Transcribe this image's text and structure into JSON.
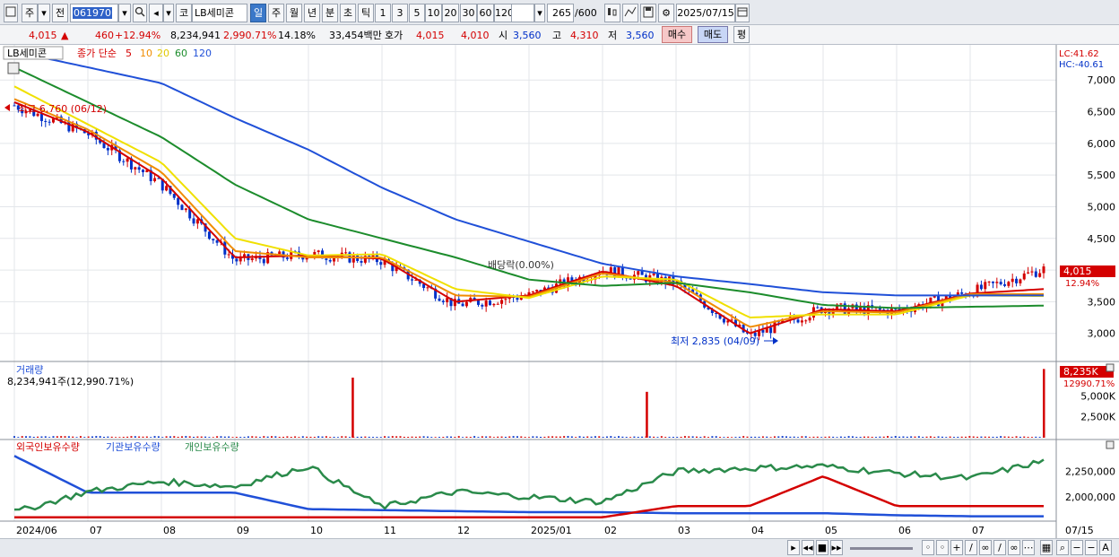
{
  "toolbar": {
    "market_1": "주",
    "market_2": "전",
    "code": "061970",
    "name_prefix": "코",
    "stock_name": "LB세미콘",
    "periods": [
      "일",
      "주",
      "월",
      "년",
      "분",
      "초",
      "틱"
    ],
    "active_period": "일",
    "intervals": [
      "1",
      "3",
      "5",
      "10",
      "20",
      "30",
      "60",
      "120"
    ],
    "count": "265",
    "count_total": "/600",
    "date": "2025/07/15"
  },
  "quote": {
    "price": "4,015",
    "change_arrow": "▲",
    "change": "460",
    "change_pct": "+12.94%",
    "volume": "8,234,941",
    "volume_ratio": "2,990.71%",
    "turnover": "14.18%",
    "amount": "33,454백만",
    "ask_label": "호가",
    "ask": "4,015",
    "bid": "4,010",
    "open_label": "시",
    "open": "3,560",
    "high_label": "고",
    "high": "4,310",
    "low_label": "저",
    "low": "3,560",
    "buy": "매수",
    "sell": "매도",
    "eval": "평"
  },
  "price_panel": {
    "name": "LB세미콘",
    "ma_label": "종가 단순",
    "ma_periods": [
      "5",
      "10",
      "20",
      "60",
      "120"
    ],
    "lc": "LC:41.62",
    "hc": "HC:-40.61",
    "high_note": "최고 6,760 (06/12)",
    "low_note": "최저 2,835 (04/09)",
    "event_note": "배당락(0.00%)",
    "last_price_tag": "4,015",
    "last_pct_tag": "12.94%"
  },
  "volume_panel": {
    "title": "거래량",
    "value": "8,234,941주(12,990.71%)",
    "tag1": "8,235K",
    "tag2": "12990.71%"
  },
  "holdings_panel": {
    "items": [
      "외국인보유수량",
      "기관보유수량",
      "개인보유수량"
    ]
  },
  "x_axis_labels": [
    "2024/06",
    "07",
    "08",
    "09",
    "10",
    "11",
    "12",
    "2025/01",
    "02",
    "03",
    "04",
    "05",
    "06",
    "07"
  ],
  "x_axis_end": "07/15",
  "colors": {
    "up": "#d40000",
    "down": "#0030c8",
    "ma5": "#d40000",
    "ma10": "#f08c00",
    "ma20": "#f0e000",
    "ma60": "#1c8c2c",
    "ma120": "#2050d8",
    "foreign": "#2050d8",
    "institution": "#d40000",
    "individual": "#2a8a4a"
  },
  "chart_data": [
    {
      "type": "line",
      "title": "LB세미콘",
      "ylabel": "",
      "y_ticks": [
        3000,
        3500,
        4000,
        4500,
        5000,
        5500,
        6000,
        6500,
        7000
      ],
      "y_tick_labels": [
        "3,000",
        "3,500",
        "4,000",
        "4,500",
        "5,000",
        "5,500",
        "6,000",
        "6,500",
        "7,000"
      ],
      "ylim": [
        2600,
        7300
      ],
      "x": [
        "2024/06",
        "07",
        "08",
        "09",
        "10",
        "11",
        "12",
        "2025/01",
        "02",
        "03",
        "04",
        "05",
        "06",
        "07"
      ],
      "series": [
        {
          "name": "종가",
          "values": [
            6600,
            6150,
            5350,
            4150,
            4250,
            4150,
            3450,
            3600,
            4000,
            3800,
            2950,
            3400,
            3350,
            3650,
            4015
          ]
        },
        {
          "name": "5",
          "values": [
            6650,
            6180,
            5450,
            4200,
            4230,
            4180,
            3500,
            3600,
            3980,
            3750,
            3000,
            3380,
            3350,
            3630,
            3700
          ]
        },
        {
          "name": "10",
          "values": [
            6700,
            6220,
            5550,
            4300,
            4200,
            4200,
            3600,
            3580,
            3950,
            3800,
            3100,
            3350,
            3330,
            3620,
            3620
          ]
        },
        {
          "name": "20",
          "values": [
            6900,
            6300,
            5700,
            4500,
            4230,
            4250,
            3700,
            3560,
            3900,
            3850,
            3250,
            3300,
            3300,
            3600,
            3590
          ]
        },
        {
          "name": "60",
          "values": [
            7200,
            6650,
            6100,
            5350,
            4800,
            4500,
            4200,
            3850,
            3750,
            3800,
            3650,
            3450,
            3400,
            3420,
            3440
          ]
        },
        {
          "name": "120",
          "values": [
            7450,
            7200,
            6950,
            6400,
            5900,
            5300,
            4800,
            4450,
            4100,
            3900,
            3780,
            3650,
            3600,
            3600,
            3600
          ]
        }
      ]
    },
    {
      "type": "bar",
      "title": "거래량",
      "y_tick_labels": [
        "2,500K",
        "5,000K"
      ],
      "y_ticks": [
        2500,
        5000
      ],
      "ylim": [
        0,
        8600
      ],
      "spikes_k": [
        {
          "x": "10",
          "value": 7200
        },
        {
          "x": "02",
          "value": 5500
        },
        {
          "x": "07/15",
          "value": 8235
        }
      ]
    },
    {
      "type": "line",
      "title": "보유수량",
      "y_ticks": [
        2000000,
        2250000
      ],
      "y_tick_labels": [
        "2,000,000",
        "2,250,000"
      ],
      "series": [
        {
          "name": "외국인보유수량",
          "values": [
            2400000,
            2040000,
            2040000,
            2040000,
            1880000,
            1870000,
            1860000,
            1850000,
            1850000,
            1840000,
            1840000,
            1840000,
            1820000,
            1810000,
            1810000
          ]
        },
        {
          "name": "기관보유수량",
          "values": [
            1800000,
            1800000,
            1800000,
            1800000,
            1800000,
            1800000,
            1800000,
            1800000,
            1800000,
            1910000,
            1910000,
            2200000,
            1910000,
            1910000,
            1910000
          ]
        },
        {
          "name": "개인보유수량",
          "values": [
            1850000,
            2050000,
            2150000,
            2100000,
            2300000,
            1900000,
            2050000,
            2000000,
            1950000,
            2250000,
            2280000,
            2300000,
            2230000,
            2180000,
            2350000
          ]
        }
      ]
    }
  ]
}
